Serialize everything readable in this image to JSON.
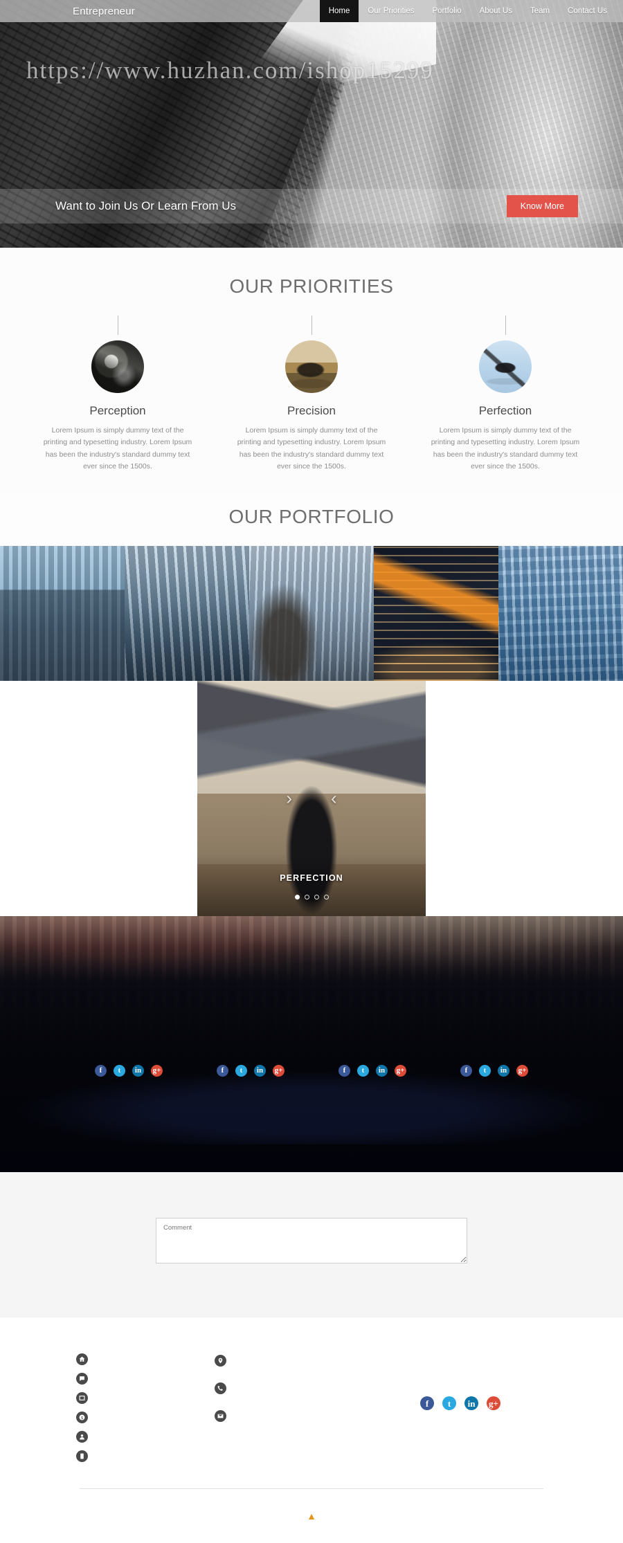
{
  "header": {
    "brand": "Entrepreneur",
    "nav": [
      {
        "label": "Home",
        "active": true
      },
      {
        "label": "Our Priorities",
        "active": false
      },
      {
        "label": "Portfolio",
        "active": false
      },
      {
        "label": "About Us",
        "active": false
      },
      {
        "label": "Team",
        "active": false
      },
      {
        "label": "Contact Us",
        "active": false
      }
    ]
  },
  "hero": {
    "watermark": "https://www.huzhan.com/ishop15299",
    "cta_text": "Want to Join Us Or Learn From Us",
    "cta_button": "Know More",
    "cta_button_color": "#e4534a"
  },
  "priorities": {
    "title": "OUR PRIORITIES",
    "cards": [
      {
        "name": "Perception",
        "desc": "Lorem Ipsum is simply dummy text of the printing and typesetting industry. Lorem Ipsum has been the industry's standard dummy text ever since the 1500s."
      },
      {
        "name": "Precision",
        "desc": "Lorem Ipsum is simply dummy text of the printing and typesetting industry. Lorem Ipsum has been the industry's standard dummy text ever since the 1500s."
      },
      {
        "name": "Perfection",
        "desc": "Lorem Ipsum is simply dummy text of the printing and typesetting industry. Lorem Ipsum has been the industry's standard dummy text ever since the 1500s."
      }
    ]
  },
  "portfolio": {
    "title": "OUR PORTFOLIO",
    "thumbs": [
      "city-skyline-thumb",
      "canary-wharf-thumb",
      "tower-thumb",
      "illuminated-building-thumb",
      "glass-office-thumb"
    ]
  },
  "slider": {
    "caption": "PERFECTION",
    "prev_arrow": "‹",
    "next_arrow": "›",
    "dots": [
      true,
      false,
      false,
      false
    ]
  },
  "team": {
    "social_groups": [
      [
        "f",
        "t",
        "in",
        "g+"
      ],
      [
        "f",
        "t",
        "in",
        "g+"
      ],
      [
        "f",
        "t",
        "in",
        "g+"
      ],
      [
        "f",
        "t",
        "in",
        "g+"
      ]
    ]
  },
  "comment": {
    "placeholder": "Comment",
    "value": ""
  },
  "footer": {
    "links_icons": [
      "home-icon",
      "chat-icon",
      "portfolio-icon",
      "pricing-icon",
      "team-icon",
      "mobile-icon"
    ],
    "contact_icons": [
      "location-icon",
      "phone-icon",
      "email-icon"
    ],
    "social": [
      {
        "glyph": "f",
        "name": "facebook",
        "color": "#3b5998"
      },
      {
        "glyph": "t",
        "name": "twitter",
        "color": "#29a9e0"
      },
      {
        "glyph": "in",
        "name": "linkedin",
        "color": "#0e76a8"
      },
      {
        "glyph": "g+",
        "name": "googleplus",
        "color": "#dd4b39"
      }
    ],
    "to_top": "▲"
  }
}
